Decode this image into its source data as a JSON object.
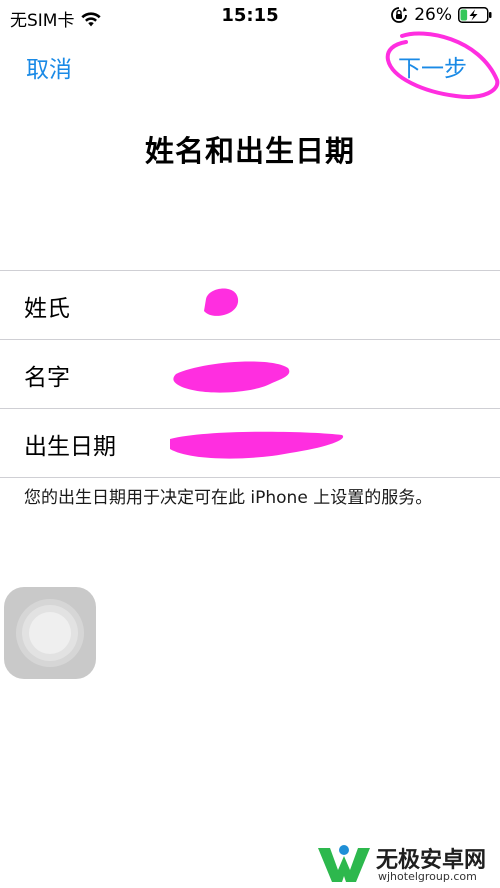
{
  "status_bar": {
    "carrier": "无SIM卡",
    "time": "15:15",
    "battery_percent": "26%",
    "battery_level": 0.26,
    "icons": [
      "wifi-icon",
      "rotation-lock-icon",
      "battery-charging-icon"
    ]
  },
  "nav": {
    "cancel_label": "取消",
    "next_label": "下一步"
  },
  "page": {
    "title": "姓名和出生日期"
  },
  "form": {
    "rows": [
      {
        "label": "姓氏"
      },
      {
        "label": "名字"
      },
      {
        "label": "出生日期"
      }
    ]
  },
  "footnote": "您的出生日期用于决定可在此 iPhone 上设置的服务。",
  "watermark": {
    "title": "无极安卓网",
    "url": "wjhotelgroup.com"
  },
  "colors": {
    "accent": "#1a8ae6",
    "annotation": "#ff2ee0",
    "battery_green": "#34c759"
  }
}
